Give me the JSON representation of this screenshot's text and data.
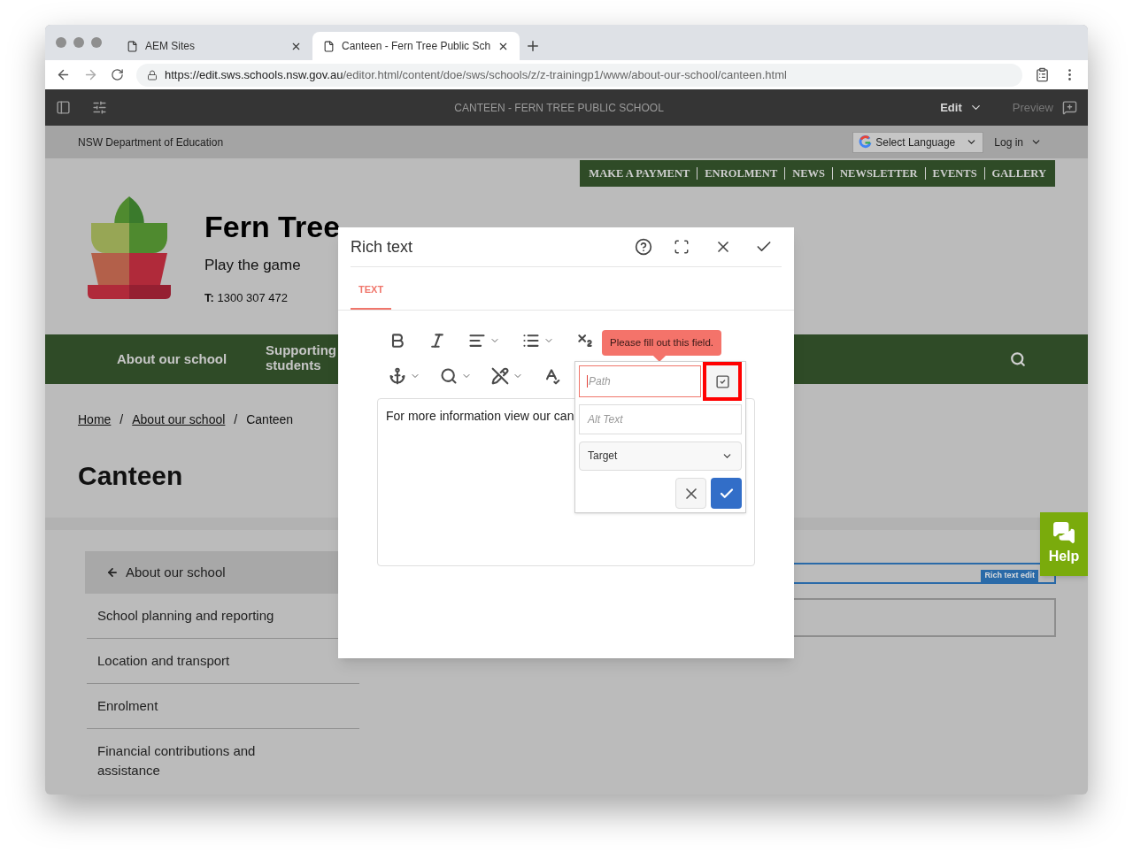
{
  "browser": {
    "tabs": [
      {
        "title": "AEM Sites",
        "selected": false
      },
      {
        "title": "Canteen - Fern Tree Public Sch",
        "selected": true
      }
    ],
    "url_host": "https://edit.sws.schools.nsw.gov.au",
    "url_path": "/editor.html/content/doe/sws/schools/z/z-trainingp1/www/about-our-school/canteen.html"
  },
  "editor_bar": {
    "page_title": "CANTEEN - FERN TREE PUBLIC SCHOOL",
    "mode": "Edit",
    "preview": "Preview"
  },
  "site": {
    "department": "NSW Department of Education",
    "language": "Select Language",
    "login": "Log in",
    "quick_links": [
      "MAKE A PAYMENT",
      "ENROLMENT",
      "NEWS",
      "NEWSLETTER",
      "EVENTS",
      "GALLERY"
    ],
    "school_name": "Fern Tree",
    "motto": "Play the game",
    "phone_label": "T:",
    "phone": "1300 307 472",
    "nav": [
      "About our school",
      "Supporting students"
    ],
    "breadcrumb_separator": "/",
    "breadcrumbs": [
      {
        "label": "Home",
        "link": true
      },
      {
        "label": "About our school",
        "link": true
      },
      {
        "label": "Canteen",
        "link": false
      }
    ],
    "heading": "Canteen",
    "side_nav": {
      "parent": "About our school",
      "items": [
        "School planning and reporting",
        "Location and transport",
        "Enrolment",
        "Financial contributions and assistance"
      ]
    },
    "component_label": "Rich text edit",
    "help": "Help"
  },
  "dialog": {
    "title": "Rich text",
    "tabs": [
      {
        "label": "TEXT",
        "selected": true
      }
    ],
    "content": "For more information view our can",
    "link_popover": {
      "error": "Please fill out this field.",
      "path": {
        "placeholder": "Path",
        "invalid": true,
        "browse_highlighted": true
      },
      "alt_text": {
        "placeholder": "Alt Text"
      },
      "target": {
        "placeholder": "Target"
      }
    }
  }
}
